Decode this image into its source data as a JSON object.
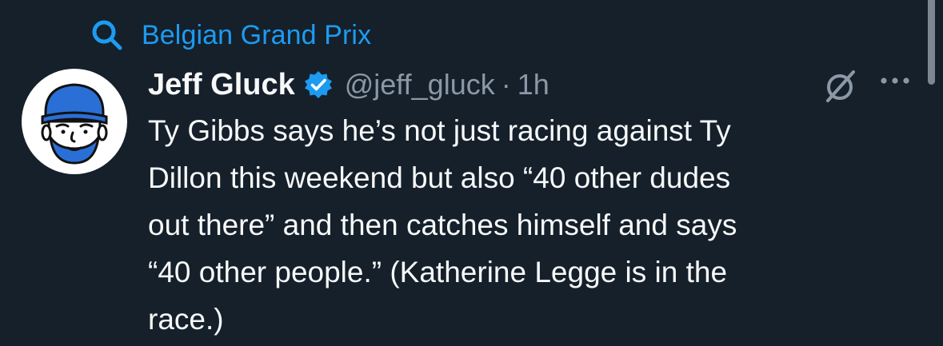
{
  "search_context": {
    "label": "Belgian Grand Prix",
    "icon": "search-icon"
  },
  "tweet": {
    "author": {
      "display_name": "Jeff Gluck",
      "handle": "@jeff_gluck",
      "verified": true,
      "avatar": "cartoon-avatar-cap-beard"
    },
    "separator": "·",
    "time": "1h",
    "text": "Ty Gibbs says he’s not just racing against Ty\nDillon this weekend but also “40 other dudes\nout there” and then catches himself and says\n“40 other people.” (Katherine Legge is in the\nrace.)",
    "actions": {
      "grok_icon": "grok-icon",
      "more_icon": "more-dots-icon"
    }
  },
  "colors": {
    "background": "#15202b",
    "accent": "#1d9bf0",
    "text_primary": "#f7f9f9",
    "text_secondary": "#8b98a5"
  }
}
